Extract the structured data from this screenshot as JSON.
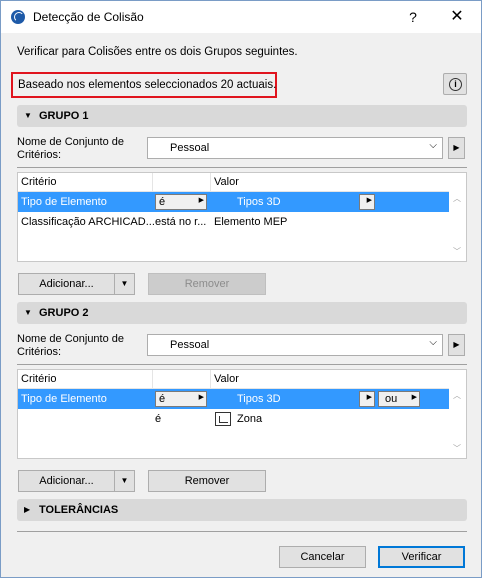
{
  "window": {
    "title": "Detecção de Colisão",
    "help_label": "?",
    "close_label": "✕"
  },
  "intro_text": "Verificar para Colisões entre os dois Grupos seguintes.",
  "selection_note": "Baseado nos elementos seleccionados 20 actuais.",
  "group1": {
    "title": "GRUPO 1",
    "criteria_set_label": "Nome de Conjunto de Critérios:",
    "criteria_set_value": "Pessoal",
    "columns": [
      "Critério",
      "Valor"
    ],
    "rows": [
      {
        "criterion": "Tipo de Elemento",
        "operator": "é",
        "value": "Tipos 3D",
        "selected": true
      },
      {
        "criterion": "Classificação ARCHICAD...",
        "operator": "está no r...",
        "value": "Elemento MEP",
        "selected": false
      }
    ],
    "add_label": "Adicionar...",
    "remove_label": "Remover",
    "remove_enabled": false
  },
  "group2": {
    "title": "GRUPO 2",
    "criteria_set_label": "Nome de Conjunto de Critérios:",
    "criteria_set_value": "Pessoal",
    "columns": [
      "Critério",
      "Valor"
    ],
    "rows": [
      {
        "criterion": "Tipo de Elemento",
        "operator": "é",
        "value": "Tipos 3D",
        "logic": "ou",
        "selected": true
      },
      {
        "criterion": "",
        "operator": "é",
        "value": "Zona",
        "icon": "zone-icon",
        "selected": false
      }
    ],
    "add_label": "Adicionar...",
    "remove_label": "Remover",
    "remove_enabled": true
  },
  "tolerances": {
    "title": "TOLERÂNCIAS"
  },
  "footer": {
    "cancel_label": "Cancelar",
    "verify_label": "Verificar"
  },
  "colors": {
    "selection": "#3399ff",
    "highlight_border": "#e0141e",
    "section_header": "#d9d9d9"
  }
}
